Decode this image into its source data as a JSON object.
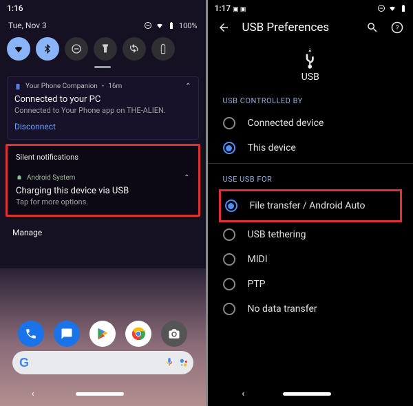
{
  "left": {
    "status": {
      "time": "1:16"
    },
    "date": "Tue, Nov 3",
    "battery_pct": "100%",
    "quick_settings": [
      {
        "name": "wifi",
        "active": true
      },
      {
        "name": "bluetooth",
        "active": true
      },
      {
        "name": "dnd",
        "active": false
      },
      {
        "name": "flashlight",
        "active": false
      },
      {
        "name": "rotation",
        "active": false
      },
      {
        "name": "battery-saver",
        "active": false
      }
    ],
    "notif1": {
      "app": "Your Phone Companion",
      "age": "16m",
      "title": "Connected to your PC",
      "body": "Connected to Your Phone app on THE-ALIEN.",
      "action": "Disconnect"
    },
    "silent_header": "Silent notifications",
    "notif2": {
      "app": "Android System",
      "title": "Charging this device via USB",
      "body": "Tap for more options."
    },
    "manage": "Manage",
    "dock_apps": [
      "Phone",
      "Messages",
      "Play Store",
      "Chrome",
      "Camera"
    ],
    "search_placeholder": ""
  },
  "right": {
    "status": {
      "time": "1:17"
    },
    "title": "USB Preferences",
    "usb_label": "USB",
    "section1": "USB CONTROLLED BY",
    "controlled_by": [
      {
        "label": "Connected device",
        "selected": false
      },
      {
        "label": "This device",
        "selected": true
      }
    ],
    "section2": "USE USB FOR",
    "use_for": [
      {
        "label": "File transfer / Android Auto",
        "selected": true,
        "highlight": true
      },
      {
        "label": "USB tethering",
        "selected": false
      },
      {
        "label": "MIDI",
        "selected": false
      },
      {
        "label": "PTP",
        "selected": false
      },
      {
        "label": "No data transfer",
        "selected": false
      }
    ]
  }
}
